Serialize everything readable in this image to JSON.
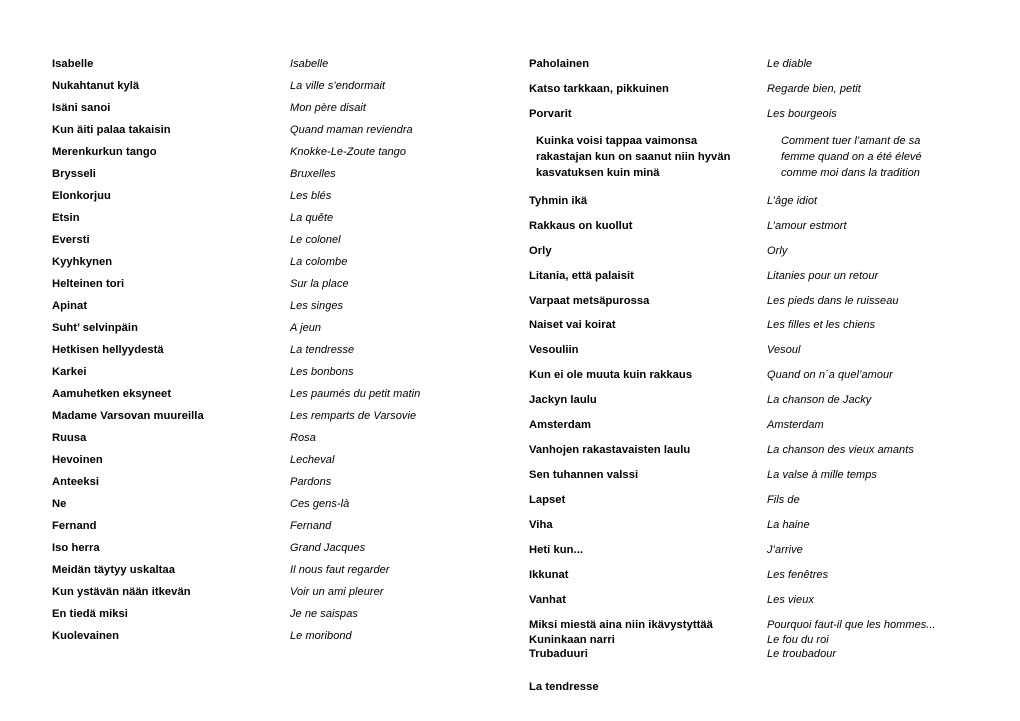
{
  "document": {
    "kind": "song-title-translation-list",
    "left_column": [
      {
        "fi": "Isabelle",
        "fr": "Isabelle"
      },
      {
        "fi": "Nukahtanut kylä",
        "fr": "La ville s’endormait"
      },
      {
        "fi": "Isäni sanoi",
        "fr": "Mon père disait"
      },
      {
        "fi": "Kun äiti palaa takaisin",
        "fr": "Quand maman reviendra"
      },
      {
        "fi": "Merenkurkun tango",
        "fr": "Knokke-Le-Zoute tango"
      },
      {
        "fi": "Brysseli",
        "fr": "Bruxelles"
      },
      {
        "fi": "Elonkorjuu",
        "fr": "Les blés"
      },
      {
        "fi": "Etsin",
        "fr": "La quête"
      },
      {
        "fi": "Eversti",
        "fr": "Le colonel"
      },
      {
        "fi": "Kyyhkynen",
        "fr": "La colombe"
      },
      {
        "fi": "Helteinen tori",
        "fr": "Sur la place"
      },
      {
        "fi": "Apinat",
        "fr": "Les singes"
      },
      {
        "fi": "Suht’ selvinpäin",
        "fr": "A jeun"
      },
      {
        "fi": "Hetkisen hellyydestä",
        "fr": "La tendresse"
      },
      {
        "fi": "Karkei",
        "fr": "Les bonbons"
      },
      {
        "fi": "Aamuhetken eksyneet",
        "fr": "Les paumés du petit matin"
      },
      {
        "fi": "Madame Varsovan muureilla",
        "fr": "Les remparts de Varsovie"
      },
      {
        "fi": "Ruusa",
        "fr": "Rosa"
      },
      {
        "fi": "Hevoinen",
        "fr": "Lecheval"
      },
      {
        "fi": "Anteeksi",
        "fr": "Pardons"
      },
      {
        "fi": "Ne",
        "fr": "Ces gens-là"
      },
      {
        "fi": "Fernand",
        "fr": "Fernand"
      },
      {
        "fi": "Iso herra",
        "fr": "Grand Jacques"
      },
      {
        "fi": "Meidän täytyy uskaltaa",
        "fr": "Il nous faut regarder"
      },
      {
        "fi": "Kun ystävän nään itkevän",
        "fr": "Voir un ami pleurer"
      },
      {
        "fi": "En tiedä miksi",
        "fr": "Je ne saispas"
      },
      {
        "fi": "Kuolevainen",
        "fr": "Le moribond"
      }
    ],
    "right_column": [
      {
        "fi": "Paholainen",
        "fr": "Le diable"
      },
      {
        "fi": "Katso tarkkaan, pikkuinen",
        "fr": "Regarde bien, petit"
      },
      {
        "fi": "Porvarit",
        "fr": "Les bourgeois"
      },
      {
        "fi": "Kuinka voisi tappaa vaimonsa\nrakastajan kun on saanut niin hyvän\nkasvatuksen kuin minä",
        "fr": "Comment tuer l’amant de sa\nfemme quand on a été élevé\ncomme moi dans la tradition",
        "style": "indented"
      },
      {
        "fi": "Tyhmin ikä",
        "fr": "L’âge idiot"
      },
      {
        "fi": "Rakkaus on kuollut",
        "fr": "L’amour estmort"
      },
      {
        "fi": "Orly",
        "fr": "Orly"
      },
      {
        "fi": "Litania, että palaisit",
        "fr": "Litanies pour un retour"
      },
      {
        "fi": "Varpaat metsäpurossa",
        "fr": "Les pieds dans le ruisseau"
      },
      {
        "fi": "Naiset vai koirat",
        "fr": "Les filles et les chiens"
      },
      {
        "fi": "Vesouliin",
        "fr": "Vesoul"
      },
      {
        "fi": "Kun ei ole muuta kuin rakkaus",
        "fr": "Quand on n´a quel’amour"
      },
      {
        "fi": "Jackyn laulu",
        "fr": "La chanson de Jacky"
      },
      {
        "fi": "Amsterdam",
        "fr": "Amsterdam"
      },
      {
        "fi": "Vanhojen rakastavaisten laulu",
        "fr": "La chanson des vieux amants"
      },
      {
        "fi": "Sen tuhannen valssi",
        "fr": "La valse à mille temps"
      },
      {
        "fi": "Lapset",
        "fr": "Fils de"
      },
      {
        "fi": "Viha",
        "fr": "La haine"
      },
      {
        "fi": "Heti kun...",
        "fr": "J’arrive"
      },
      {
        "fi": "Ikkunat",
        "fr": "Les fenêtres"
      },
      {
        "fi": "Vanhat",
        "fr": "Les vieux"
      },
      {
        "fi": "Miksi miestä aina niin ikävystyttää",
        "fr": "Pourquoi faut-il que les hommes...",
        "style": "tight"
      },
      {
        "fi": "Kuninkaan narri",
        "fr": "Le fou du roi",
        "style": "tight"
      },
      {
        "fi": "Trubaduuri",
        "fr": "Le troubadour",
        "style": "tight"
      },
      {
        "fi": "La tendresse",
        "fr": "",
        "style": "orphan"
      }
    ]
  }
}
